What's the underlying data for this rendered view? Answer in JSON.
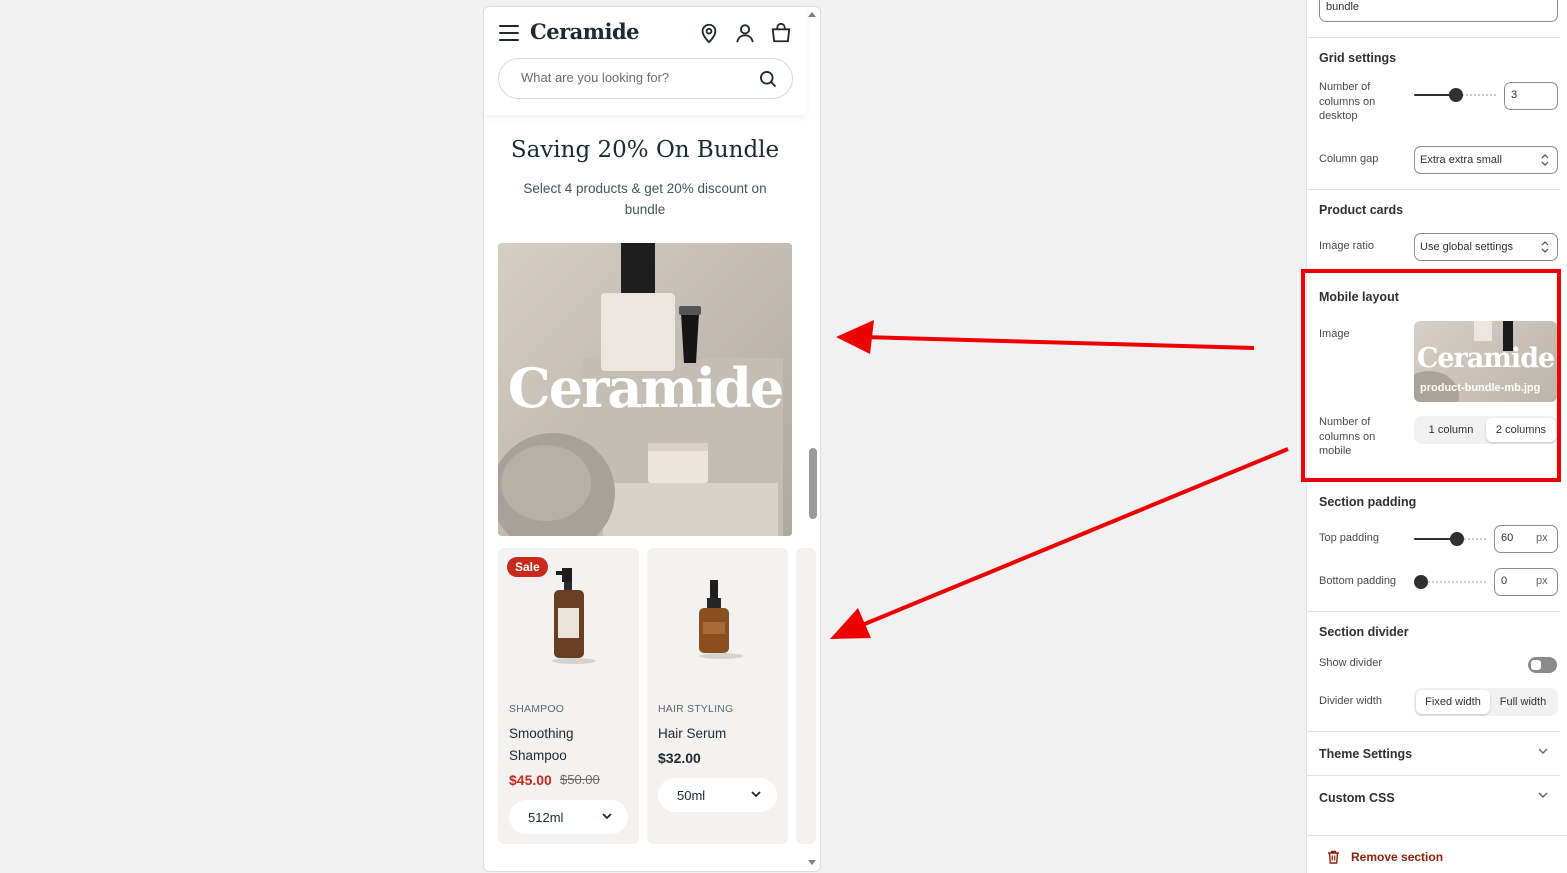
{
  "preview": {
    "brand": "Ceramide",
    "search_placeholder": "What are you looking for?",
    "heading": "Saving 20% On Bundle",
    "subheading": "Select 4 products & get 20% discount on bundle",
    "banner_text": "Ceramide",
    "products": [
      {
        "badge": "Sale",
        "category": "SHAMPOO",
        "name": "Smoothing Shampoo",
        "price": "$45.00",
        "compare_price": "$50.00",
        "variant": "512ml"
      },
      {
        "badge": "",
        "category": "HAIR STYLING",
        "name": "Hair Serum",
        "price": "$32.00",
        "compare_price": "",
        "variant": "50ml"
      }
    ],
    "icons": [
      "menu-icon",
      "location-pin-icon",
      "account-icon",
      "cart-icon",
      "search-icon",
      "chevron-down-icon"
    ]
  },
  "settings": {
    "top_field_value": "bundle",
    "grid": {
      "title": "Grid settings",
      "columns_label": "Number of columns on desktop",
      "columns_value": "3",
      "columns_level": 3,
      "gap_label": "Column gap",
      "gap_value": "Extra extra small"
    },
    "product_cards": {
      "title": "Product cards",
      "ratio_label": "Image ratio",
      "ratio_value": "Use global settings"
    },
    "mobile_layout": {
      "title": "Mobile layout",
      "image_label": "Image",
      "image_brand": "Ceramide",
      "image_filename": "product-bundle-mb.jpg",
      "columns_label": "Number of columns on mobile",
      "options": [
        "1 column",
        "2 columns"
      ],
      "selected": "2 columns"
    },
    "section_padding": {
      "title": "Section padding",
      "top_label": "Top padding",
      "top_value": "60",
      "bottom_label": "Bottom padding",
      "bottom_value": "0",
      "unit": "px"
    },
    "section_divider": {
      "title": "Section divider",
      "show_label": "Show divider",
      "show_value": false,
      "width_label": "Divider width",
      "width_options": [
        "Fixed width",
        "Full width"
      ],
      "width_selected": "Fixed width"
    },
    "theme_settings": "Theme Settings",
    "custom_css": "Custom CSS",
    "remove": "Remove section"
  },
  "colors": {
    "sale": "#c8291c",
    "highlight": "#ef0000",
    "brand_text": "#1b2a33",
    "danger": "#8e1f0b"
  }
}
